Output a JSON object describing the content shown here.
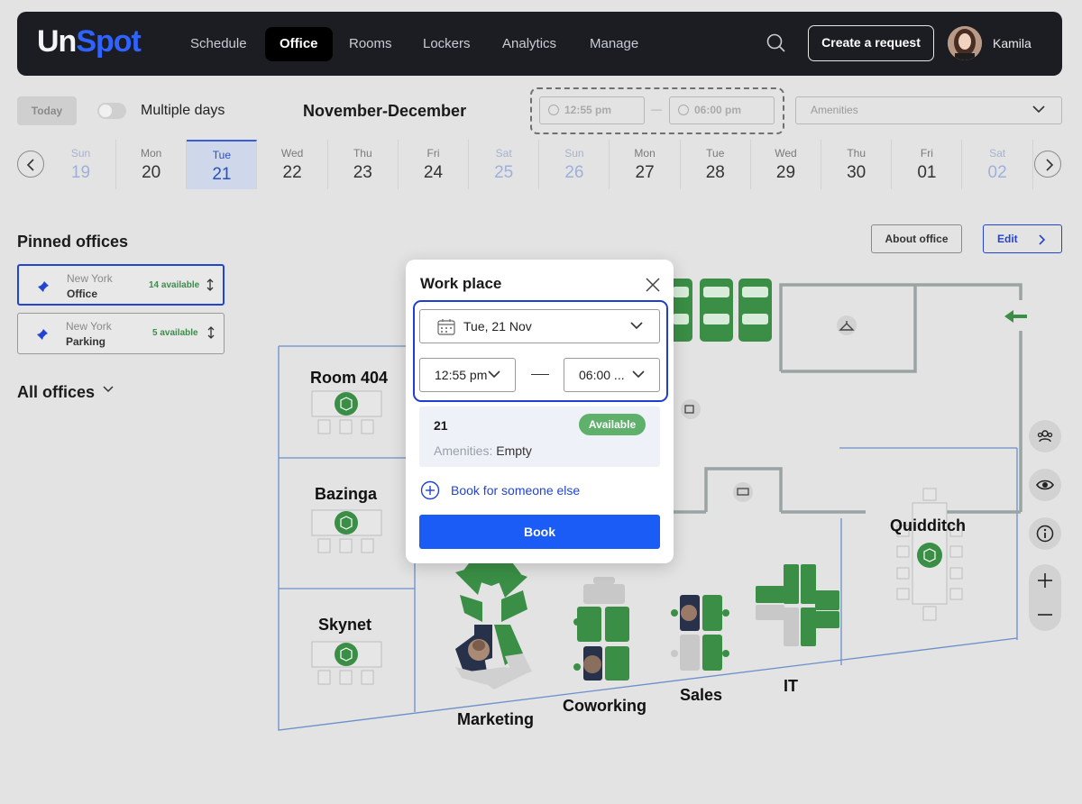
{
  "header": {
    "logo_un": "Un",
    "logo_spot": "Spot",
    "nav": [
      {
        "label": "Schedule",
        "active": false
      },
      {
        "label": "Office",
        "active": true
      },
      {
        "label": "Rooms",
        "active": false
      },
      {
        "label": "Lockers",
        "active": false
      },
      {
        "label": "Analytics",
        "active": false
      },
      {
        "label": "Manage",
        "active": false
      }
    ],
    "create_request": "Create a request",
    "user_name": "Kamila"
  },
  "toolbar": {
    "today": "Today",
    "multiple_days": "Multiple days",
    "month_range": "November-December",
    "time_from": "12:55 pm",
    "time_sep": "—",
    "time_to": "06:00 pm",
    "amenities_placeholder": "Amenities"
  },
  "days": [
    {
      "name": "Sun",
      "date": "19",
      "weekend": true
    },
    {
      "name": "Mon",
      "date": "20"
    },
    {
      "name": "Tue",
      "date": "21",
      "selected": true
    },
    {
      "name": "Wed",
      "date": "22"
    },
    {
      "name": "Thu",
      "date": "23"
    },
    {
      "name": "Fri",
      "date": "24"
    },
    {
      "name": "Sat",
      "date": "25",
      "weekend": true
    },
    {
      "name": "Sun",
      "date": "26",
      "weekend": true
    },
    {
      "name": "Mon",
      "date": "27"
    },
    {
      "name": "Tue",
      "date": "28"
    },
    {
      "name": "Wed",
      "date": "29"
    },
    {
      "name": "Thu",
      "date": "30"
    },
    {
      "name": "Fri",
      "date": "01"
    },
    {
      "name": "Sat",
      "date": "02",
      "weekend": true
    }
  ],
  "sidebar": {
    "pinned_title": "Pinned offices",
    "pinned": [
      {
        "city": "New York",
        "type": "Office",
        "available": "14 available",
        "active": true
      },
      {
        "city": "New York",
        "type": "Parking",
        "available": "5 available",
        "active": false
      }
    ],
    "all_offices": "All offices"
  },
  "office_actions": {
    "about": "About office",
    "edit": "Edit"
  },
  "map": {
    "rooms": {
      "room404": "Room 404",
      "bazinga": "Bazinga",
      "skynet": "Skynet",
      "quidditch": "Quidditch",
      "marketing": "Marketing",
      "coworking": "Coworking",
      "sales": "Sales",
      "it": "IT"
    },
    "colors": {
      "seat_free": "#3a8e45",
      "seat_busy": "#c8c8c8",
      "wall": "#9aa5a3",
      "zone_line": "#6c8fc9"
    }
  },
  "popup": {
    "title": "Work place",
    "date": "Tue, 21 Nov",
    "time_from": "12:55 pm",
    "time_to": "06:00 ...",
    "seat_number": "21",
    "status": "Available",
    "amenities_label": "Amenities:",
    "amenities_value": "Empty",
    "book_someone": "Book for someone else",
    "book": "Book"
  }
}
